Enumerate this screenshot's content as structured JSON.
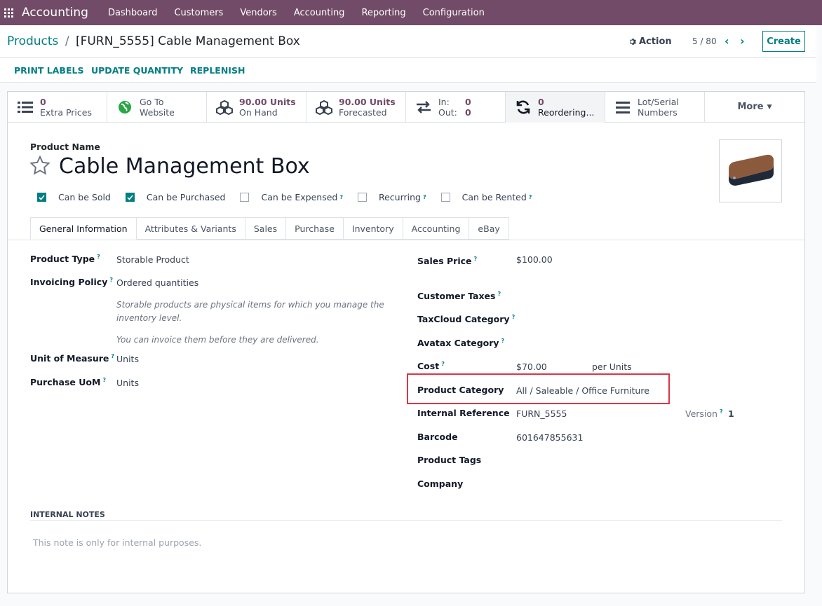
{
  "navbar": {
    "app_name": "Accounting",
    "menu": [
      "Dashboard",
      "Customers",
      "Vendors",
      "Accounting",
      "Reporting",
      "Configuration"
    ]
  },
  "control": {
    "breadcrumb_parent": "Products",
    "breadcrumb_sep": "/",
    "breadcrumb_current": "[FURN_5555] Cable Management Box",
    "action_label": "Action",
    "pager": "5 / 80",
    "create_label": "Create"
  },
  "status_actions": [
    "PRINT LABELS",
    "UPDATE QUANTITY",
    "REPLENISH"
  ],
  "smart_buttons": {
    "extra_prices": {
      "num": "0",
      "label": "Extra Prices",
      "icon": "list-icon"
    },
    "website": {
      "line1": "Go To",
      "line2": "Website",
      "icon": "globe-icon"
    },
    "on_hand": {
      "num": "90.00 Units",
      "label": "On Hand",
      "icon": "cubes-icon"
    },
    "forecasted": {
      "num": "90.00 Units",
      "label": "Forecasted",
      "icon": "cubes-icon"
    },
    "in_out": {
      "in_label": "In:",
      "in_val": "0",
      "out_label": "Out:",
      "out_val": "0",
      "icon": "exchange-icon"
    },
    "reordering": {
      "num": "0",
      "label": "Reordering...",
      "icon": "refresh-icon"
    },
    "lots": {
      "line1": "Lot/Serial",
      "line2": "Numbers",
      "icon": "bars-icon"
    },
    "more": "More"
  },
  "product": {
    "name_label": "Product Name",
    "name": "Cable Management Box",
    "checkboxes": [
      {
        "label": "Can be Sold",
        "checked": true,
        "help": false
      },
      {
        "label": "Can be Purchased",
        "checked": true,
        "help": false
      },
      {
        "label": "Can be Expensed",
        "checked": false,
        "help": true
      },
      {
        "label": "Recurring",
        "checked": false,
        "help": true
      },
      {
        "label": "Can be Rented",
        "checked": false,
        "help": true
      }
    ]
  },
  "tabs": [
    "General Information",
    "Attributes & Variants",
    "Sales",
    "Purchase",
    "Inventory",
    "Accounting",
    "eBay"
  ],
  "left_fields": {
    "product_type": {
      "label": "Product Type",
      "value": "Storable Product"
    },
    "invoicing_policy": {
      "label": "Invoicing Policy",
      "value": "Ordered quantities"
    },
    "help_1a": "Storable products are physical items for which you manage the",
    "help_1b": "inventory level.",
    "help_2": "You can invoice them before they are delivered.",
    "uom": {
      "label": "Unit of Measure",
      "value": "Units"
    },
    "purchase_uom": {
      "label": "Purchase UoM",
      "value": "Units"
    }
  },
  "right_fields": {
    "sales_price": {
      "label": "Sales Price",
      "value": "$100.00"
    },
    "customer_taxes": {
      "label": "Customer Taxes"
    },
    "taxcloud": {
      "label": "TaxCloud Category"
    },
    "avatax": {
      "label": "Avatax Category"
    },
    "cost": {
      "label": "Cost",
      "value": "$70.00",
      "suffix": "per Units"
    },
    "category": {
      "label": "Product Category",
      "value": "All / Saleable / Office Furniture"
    },
    "internal_ref": {
      "label": "Internal Reference",
      "value": "FURN_5555"
    },
    "version": {
      "label": "Version",
      "value": "1"
    },
    "barcode": {
      "label": "Barcode",
      "value": "601647855631"
    },
    "tags": {
      "label": "Product Tags"
    },
    "company": {
      "label": "Company"
    }
  },
  "notes": {
    "title": "INTERNAL NOTES",
    "placeholder": "This note is only for internal purposes."
  },
  "colors": {
    "brand": "#714b67",
    "accent": "#017e84",
    "highlight": "#dc3545"
  }
}
